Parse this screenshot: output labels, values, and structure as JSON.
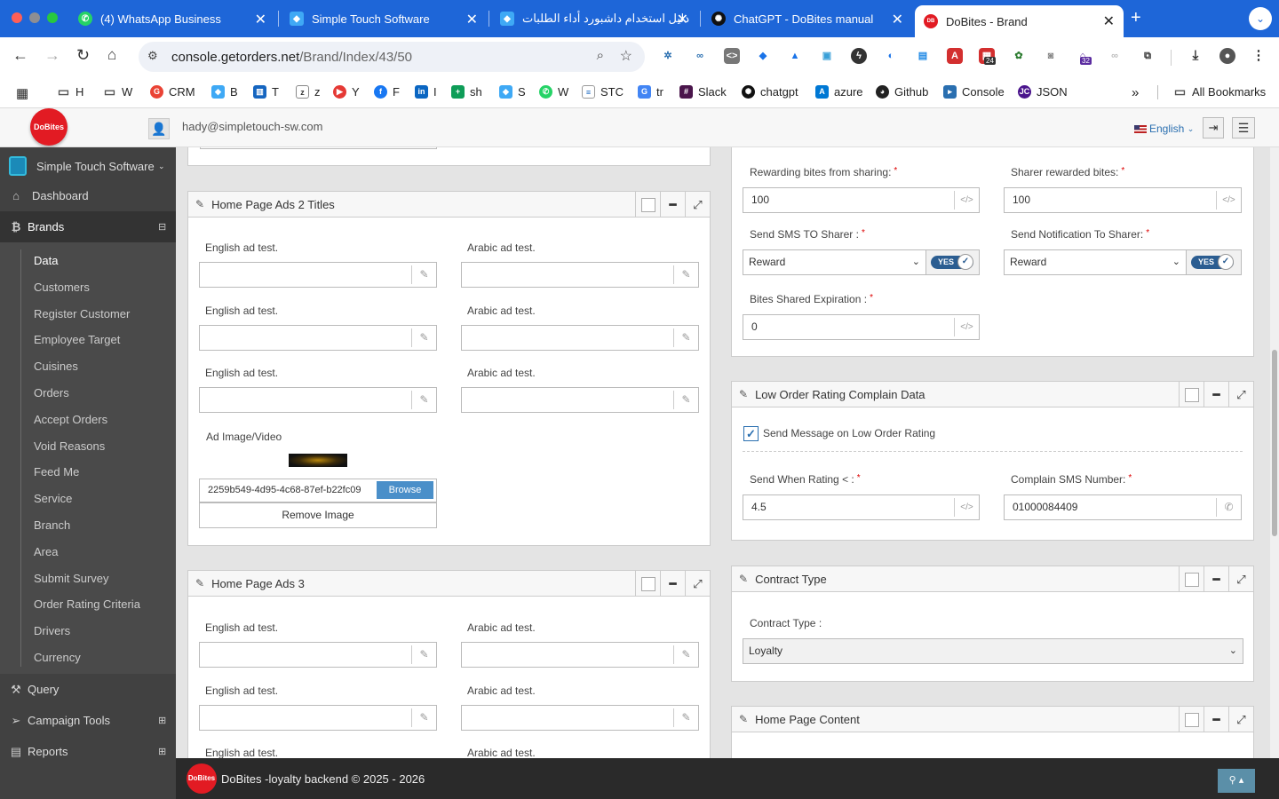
{
  "browser": {
    "tabs": [
      {
        "title": "(4) WhatsApp Business"
      },
      {
        "title": "Simple Touch Software"
      },
      {
        "title": "دليل استخدام داشبورد أداء الطلبات"
      },
      {
        "title": "ChatGPT - DoBites manual"
      },
      {
        "title": "DoBites - Brand"
      }
    ],
    "url_host": "console.getorders.net",
    "url_path": "/Brand/Index/43/50",
    "ext_badge_1": "24",
    "ext_badge_2": "32",
    "bookmarks": [
      "H",
      "W",
      "CRM",
      "B",
      "T",
      "z",
      "Y",
      "F",
      "I",
      "sh",
      "S",
      "W",
      "STC",
      "tr",
      "Slack",
      "chatgpt",
      "azure",
      "Github",
      "Console",
      "JSON"
    ],
    "all_bookmarks": "All Bookmarks"
  },
  "app": {
    "logo_text": "DoBites",
    "user_email": "hady@simpletouch-sw.com",
    "language": "English",
    "company": "Simple Touch Software"
  },
  "sidebar": {
    "dashboard": "Dashboard",
    "brands": "Brands",
    "brand_items": [
      "Data",
      "Customers",
      "Register Customer",
      "Employee Target",
      "Cuisines",
      "Orders",
      "Accept Orders",
      "Void Reasons",
      "Feed Me",
      "Service",
      "Branch",
      "Area",
      "Submit Survey",
      "Order Rating Criteria",
      "Drivers",
      "Currency"
    ],
    "query": "Query",
    "campaign_tools": "Campaign Tools",
    "reports": "Reports"
  },
  "ads2": {
    "title": "Home Page Ads 2 Titles",
    "english_label": "English ad test.",
    "arabic_label": "Arabic ad test.",
    "image_label": "Ad Image/Video",
    "file_value": "2259b549-4d95-4c68-87ef-b22fc09",
    "browse": "Browse",
    "remove": "Remove Image"
  },
  "ads3": {
    "title": "Home Page Ads 3",
    "english_label": "English ad test.",
    "arabic_label": "Arabic ad test."
  },
  "sharing": {
    "rewarding_label": "Rewarding bites from sharing:",
    "rewarding_value": "100",
    "sharer_label": "Sharer rewarded bites:",
    "sharer_value": "100",
    "sms_label": "Send SMS TO Sharer :",
    "sms_value": "Reward",
    "notif_label": "Send Notification To Sharer:",
    "notif_value": "Reward",
    "toggle_yes": "YES",
    "expiration_label": "Bites Shared Expiration :",
    "expiration_value": "0"
  },
  "low_rating": {
    "title": "Low Order Rating Complain Data",
    "checkbox_label": "Send Message on Low Order Rating",
    "checkbox_checked": true,
    "rating_label": "Send When Rating < :",
    "rating_value": "4.5",
    "sms_label": "Complain SMS Number:",
    "sms_value": "01000084409"
  },
  "contract": {
    "title": "Contract Type",
    "label": "Contract Type :",
    "value": "Loyalty"
  },
  "home_content": {
    "title": "Home Page Content"
  },
  "footer": {
    "text": "DoBites -loyalty backend © 2025 - 2026"
  }
}
